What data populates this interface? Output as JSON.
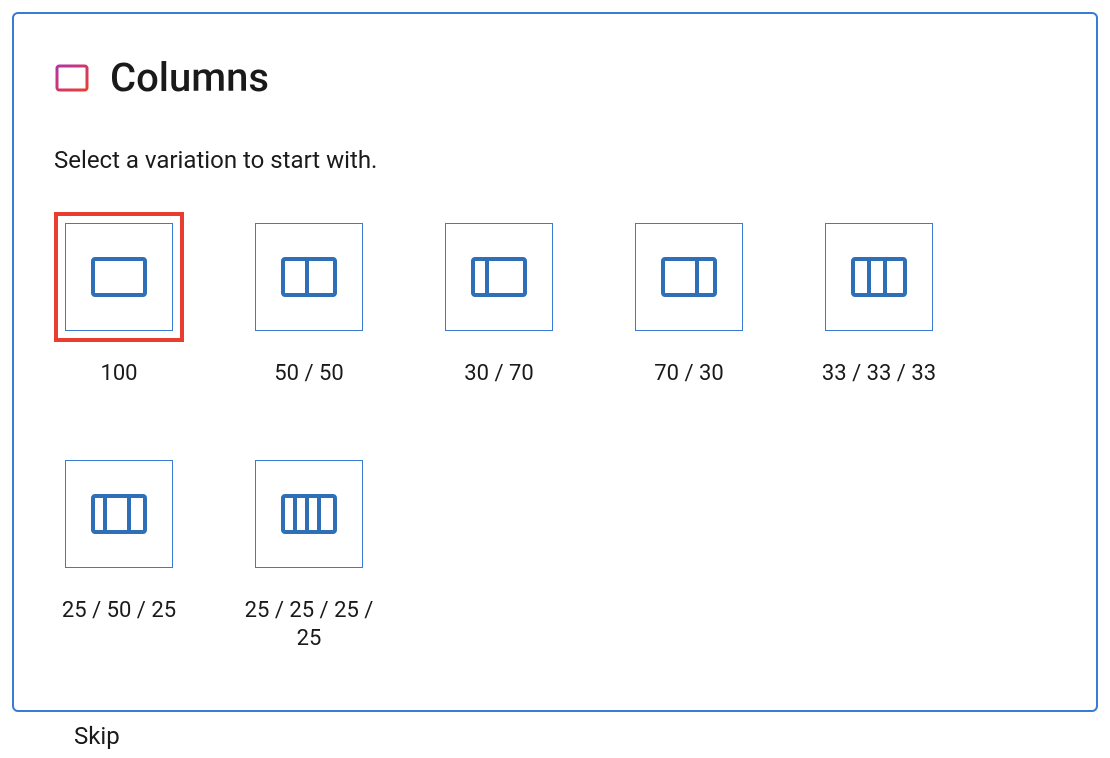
{
  "header": {
    "title": "Columns"
  },
  "instruction": "Select a variation to start with.",
  "variations": [
    {
      "label": "100",
      "cols": [
        100
      ],
      "selected": true
    },
    {
      "label": "50 / 50",
      "cols": [
        50,
        50
      ],
      "selected": false
    },
    {
      "label": "30 / 70",
      "cols": [
        30,
        70
      ],
      "selected": false
    },
    {
      "label": "70 / 30",
      "cols": [
        70,
        30
      ],
      "selected": false
    },
    {
      "label": "33 / 33 / 33",
      "cols": [
        33.33,
        33.33,
        33.34
      ],
      "selected": false
    },
    {
      "label": "25 / 50 / 25",
      "cols": [
        25,
        50,
        25
      ],
      "selected": false
    },
    {
      "label": "25 / 25 / 25 / 25",
      "cols": [
        25,
        25,
        25,
        25
      ],
      "selected": false
    }
  ],
  "skip_label": "Skip",
  "colors": {
    "border": "#3a7bd5",
    "icon": "#2f6fb7",
    "selection": "#e93e2f",
    "gradient_start": "#b233a6",
    "gradient_end": "#e93e2f"
  }
}
